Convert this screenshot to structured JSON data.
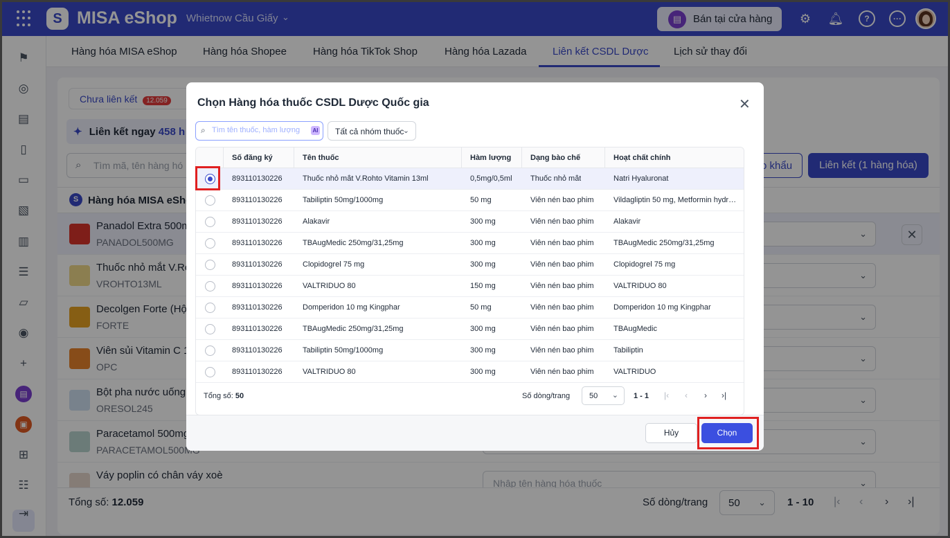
{
  "topbar": {
    "app_title": "MISA eShop",
    "store_name": "Whietnow Cầu Giấy",
    "sell_button": "Bán tại cửa hàng",
    "icons": [
      "gear-icon",
      "bell-icon",
      "help-icon",
      "more-icon"
    ]
  },
  "tabs": [
    {
      "label": "Hàng hóa MISA eShop"
    },
    {
      "label": "Hàng hóa Shopee"
    },
    {
      "label": "Hàng hóa TikTok Shop"
    },
    {
      "label": "Hàng hóa Lazada"
    },
    {
      "label": "Liên kết CSDL Dược",
      "active": true
    },
    {
      "label": "Lịch sử thay đổi"
    }
  ],
  "page": {
    "segment_label": "Chưa liên kết",
    "segment_badge": "12.059",
    "link_now_label": "Liên kết ngay",
    "link_now_count": "458 h",
    "search_placeholder": "Tìm mã, tên hàng hó",
    "import_button": "o khẩu",
    "link_button": "Liên kết (1 hàng hóa)",
    "section_title": "Hàng hóa MISA eSho",
    "select_placeholder": "Nhập tên hàng hóa thuốc",
    "products": [
      {
        "name": "Panadol Extra 500m",
        "code": "PANADOL500MG"
      },
      {
        "name": "Thuốc nhỏ mắt V.Ro",
        "code": "VROHTO13ML"
      },
      {
        "name": "Decolgen Forte (Hộ",
        "code": "FORTE"
      },
      {
        "name": "Viên sủi Vitamin C 1",
        "code": "OPC"
      },
      {
        "name": "Bột pha nước uống",
        "code": "ORESOL245"
      },
      {
        "name": "Paracetamol 500mg",
        "code": "PARACETAMOL500MG"
      },
      {
        "name": "Váy poplin có chân váy xoè",
        "code": ""
      }
    ],
    "footer": {
      "total_label": "Tổng số:",
      "total_value": "12.059",
      "per_page_label": "Số dòng/trang",
      "per_page_value": "50",
      "range": "1 - 10"
    }
  },
  "modal": {
    "title": "Chọn Hàng hóa thuốc CSDL Dược Quốc gia",
    "search_placeholder": "Tìm tên thuốc, hàm lượng",
    "ai_badge": "AI",
    "filter_label": "Tất cả nhóm thuốc",
    "columns": [
      "Số đăng ký",
      "Tên thuốc",
      "Hàm lượng",
      "Dạng bào chế",
      "Hoạt chất chính"
    ],
    "rows": [
      {
        "reg": "893110130226",
        "name": "Thuốc nhỏ mắt V.Rohto Vitamin 13ml",
        "dose": "0,5mg/0,5ml",
        "form": "Thuốc nhỏ mắt",
        "active": "Natri Hyaluronat",
        "selected": true
      },
      {
        "reg": "893110130226",
        "name": "Tabiliptin 50mg/1000mg",
        "dose": "50 mg",
        "form": "Viên nén bao phim",
        "active": "Vildagliptin 50 mg, Metformin hydrochloride 1000 mg",
        "selected": false
      },
      {
        "reg": "893110130226",
        "name": "Alakavir",
        "dose": "300 mg",
        "form": "Viên nén bao phim",
        "active": "Alakavir",
        "selected": false
      },
      {
        "reg": "893110130226",
        "name": "TBAugMedic 250mg/31,25mg",
        "dose": "300 mg",
        "form": "Viên nén bao phim",
        "active": "TBAugMedic 250mg/31,25mg",
        "selected": false
      },
      {
        "reg": "893110130226",
        "name": "Clopidogrel 75 mg",
        "dose": "300 mg",
        "form": "Viên nén bao phim",
        "active": "Clopidogrel 75 mg",
        "selected": false
      },
      {
        "reg": "893110130226",
        "name": "VALTRIDUO 80",
        "dose": "150 mg",
        "form": "Viên nén bao phim",
        "active": "VALTRIDUO 80",
        "selected": false
      },
      {
        "reg": "893110130226",
        "name": "Domperidon 10 mg Kingphar",
        "dose": "50 mg",
        "form": "Viên nén bao phim",
        "active": "Domperidon 10 mg Kingphar",
        "selected": false
      },
      {
        "reg": "893110130226",
        "name": "TBAugMedic 250mg/31,25mg",
        "dose": "300 mg",
        "form": "Viên nén bao phim",
        "active": "TBAugMedic",
        "selected": false
      },
      {
        "reg": "893110130226",
        "name": "Tabiliptin 50mg/1000mg",
        "dose": "300 mg",
        "form": "Viên nén bao phim",
        "active": "Tabiliptin",
        "selected": false
      },
      {
        "reg": "893110130226",
        "name": "VALTRIDUO 80",
        "dose": "300 mg",
        "form": "Viên nén bao phim",
        "active": "VALTRIDUO",
        "selected": false
      }
    ],
    "footer": {
      "total_label": "Tổng số:",
      "total_value": "50",
      "per_page_label": "Số dòng/trang",
      "per_page_value": "50",
      "range": "1 - 1"
    },
    "cancel_button": "Hủy",
    "choose_button": "Chọn"
  },
  "colors": {
    "brand": "#3949c9",
    "highlight_box": "#e02020"
  }
}
